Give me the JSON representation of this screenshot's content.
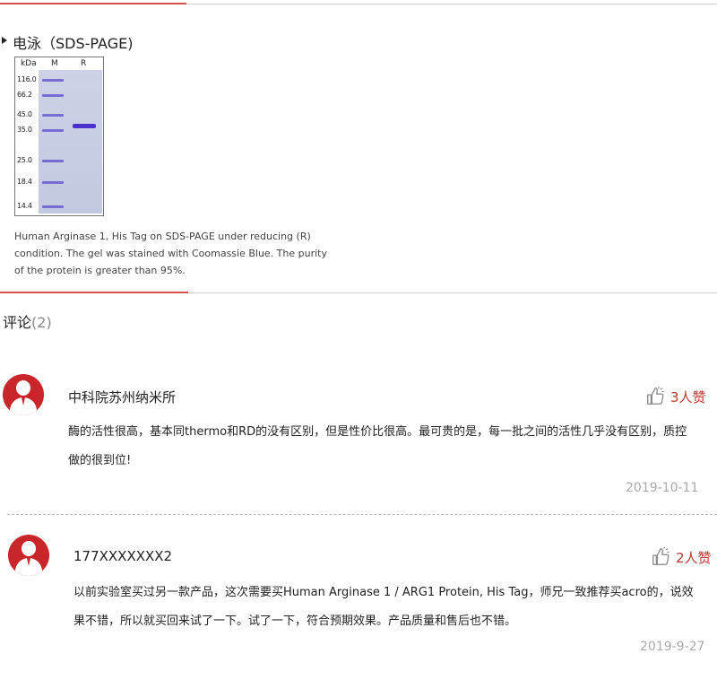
{
  "section": {
    "heading": "电泳（SDS-PAGE)"
  },
  "gel": {
    "unit_label": "kDa",
    "lane_marker": "M",
    "lane_reducing": "R",
    "markers": [
      "116.0",
      "66.2",
      "45.0",
      "35.0",
      "25.0",
      "18.4",
      "14.4"
    ]
  },
  "caption": "Human Arginase 1, His Tag on SDS-PAGE under reducing (R) condition. The gel was stained with Coomassie Blue. The purity of the protein is greater than 95%.",
  "comments": {
    "title": "评论",
    "count": "(2)",
    "items": [
      {
        "user": "中科院苏州纳米所",
        "likes": "3人赞",
        "text": "酶的活性很高，基本同thermo和RD的没有区别，但是性价比很高。最可贵的是，每一批之间的活性几乎没有区别，质控做的很到位!",
        "date": "2019-10-11"
      },
      {
        "user": "177XXXXXXX2",
        "likes": "2人赞",
        "text": "以前实验室买过另一款产品，这次需要买Human Arginase 1 / ARG1 Protein, His Tag，师兄一致推荐买acro的，说效果不错，所以就买回来试了一下。试了一下，符合预期效果。产品质量和售后也不错。",
        "date": "2019-9-27"
      }
    ]
  },
  "colors": {
    "accent": "#d9534f",
    "avatar": "#c8262b",
    "like": "#c0392b"
  },
  "icons": [
    "thumbs-up-icon",
    "user-avatar-icon"
  ]
}
